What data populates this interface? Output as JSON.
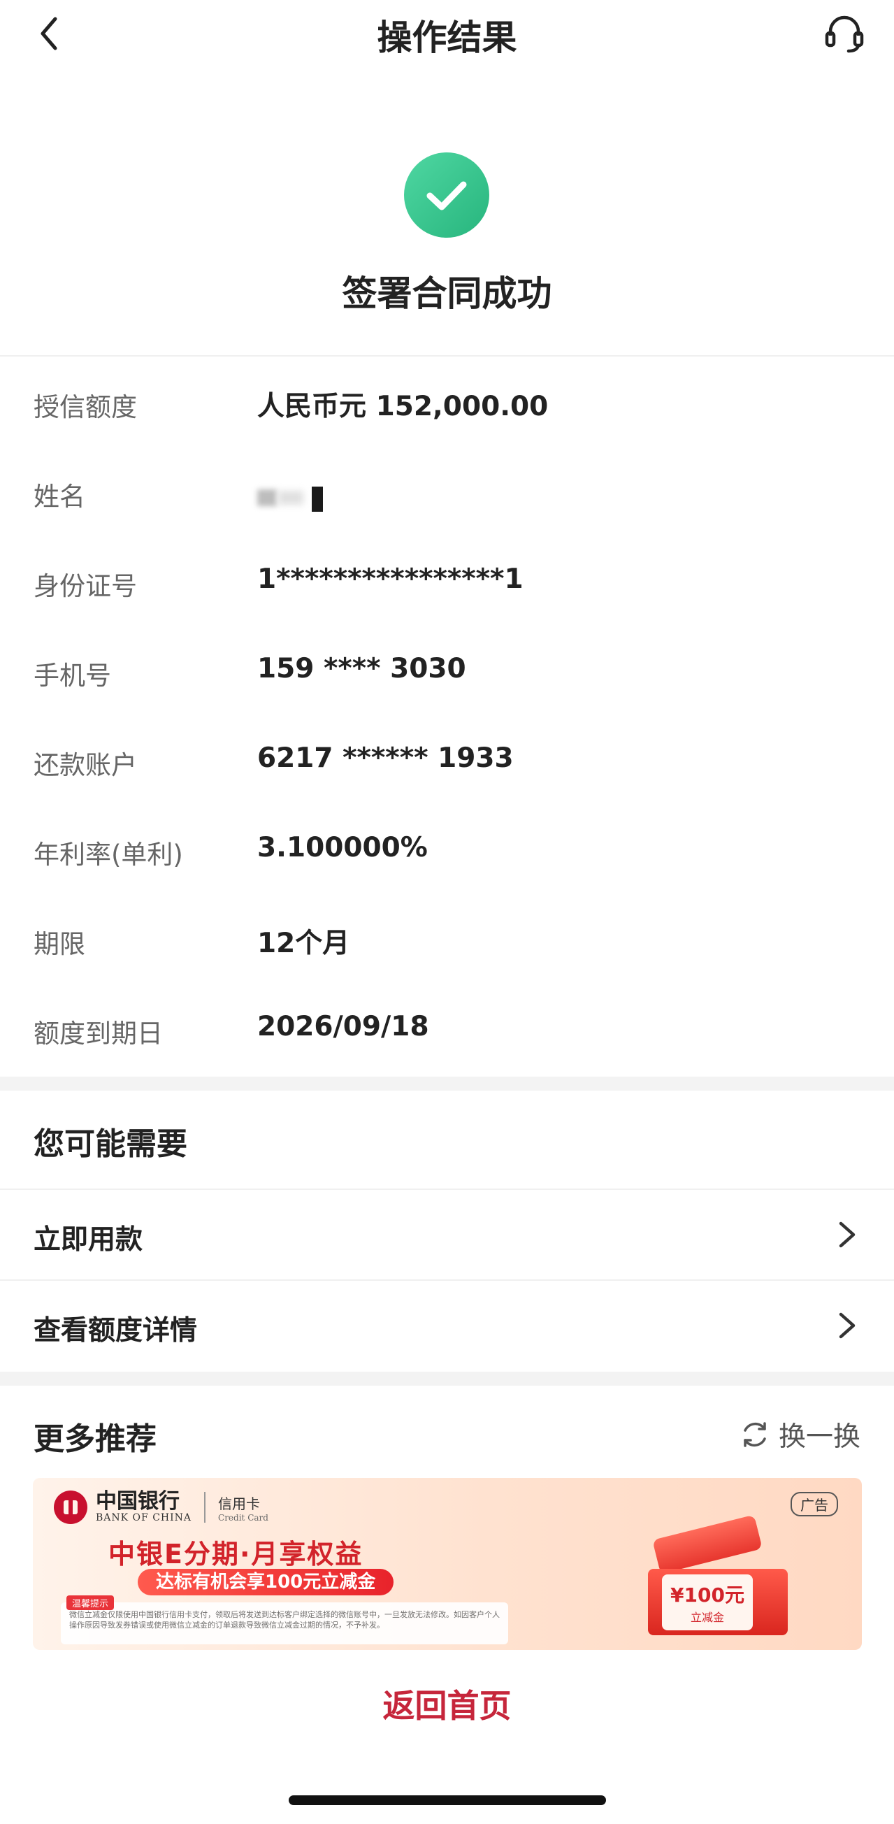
{
  "header": {
    "title": "操作结果",
    "back_icon": "chevron-left-icon",
    "service_icon": "headset-icon"
  },
  "result": {
    "title": "签署合同成功",
    "icon": "check-circle-icon",
    "icon_color": "#2fc48a"
  },
  "details": [
    {
      "label": "授信额度",
      "value": "人民币元 152,000.00"
    },
    {
      "label": "姓名",
      "value": ""
    },
    {
      "label": "身份证号",
      "value": "1****************1"
    },
    {
      "label": "手机号",
      "value": "159 **** 3030"
    },
    {
      "label": "还款账户",
      "value": "6217 ****** 1933"
    },
    {
      "label": "年利率(单利)",
      "value": "3.100000%"
    },
    {
      "label": "期限",
      "value": "12个月"
    },
    {
      "label": "额度到期日",
      "value": "2026/09/18"
    }
  ],
  "maybe_need": {
    "title": "您可能需要",
    "items": [
      {
        "label": "立即用款"
      },
      {
        "label": "查看额度详情"
      }
    ]
  },
  "recommend": {
    "title": "更多推荐",
    "refresh_label": "换一换"
  },
  "banner": {
    "bank_name": "中国银行",
    "bank_en": "BANK OF CHINA",
    "card_cn": "信用卡",
    "card_en": "Credit Card",
    "ad_tag": "广告",
    "title": "中银E分期·月享权益",
    "subtitle": "达标有机会享100元立减金",
    "tips_tag": "温馨提示",
    "tips_text": "微信立减金仅限使用中国银行信用卡支付，领取后将发送到达标客户绑定选择的微信账号中，一旦发放无法修改。如因客户个人操作原因导致发券错误或使用微信立减金的订单退款导致微信立减金过期的情况，不予补发。",
    "coupon_amount": "¥100元",
    "coupon_label": "立减金",
    "brand_color": "#c8102e"
  },
  "footer": {
    "home_label": "返回首页",
    "accent": "#c6263b"
  }
}
